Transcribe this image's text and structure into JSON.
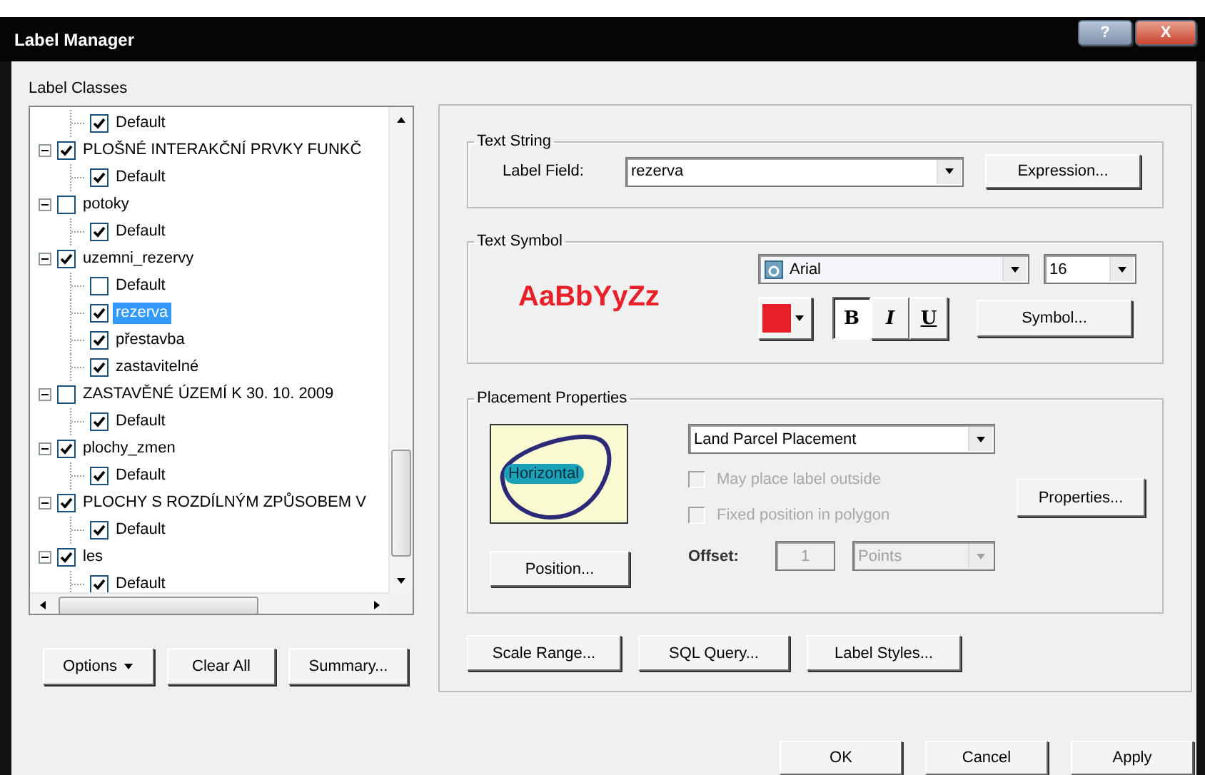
{
  "window": {
    "title": "Label Manager",
    "title_buttons": [
      {
        "label": "?",
        "kind": "help"
      },
      {
        "label": "X",
        "kind": "close"
      }
    ]
  },
  "label_classes": {
    "title": "Label Classes",
    "tree": {
      "continued_children": [
        {
          "label": "Default",
          "checked": true,
          "selected": false
        }
      ],
      "items": [
        {
          "label": "PLOŠNÉ INTERAKČNÍ PRVKY FUNKČ",
          "checked": true,
          "expanded": true,
          "selected": false,
          "children": [
            {
              "label": "Default",
              "checked": true,
              "selected": false
            }
          ]
        },
        {
          "label": "potoky",
          "checked": false,
          "expanded": true,
          "selected": false,
          "children": [
            {
              "label": "Default",
              "checked": true,
              "selected": false
            }
          ]
        },
        {
          "label": "uzemni_rezervy",
          "checked": true,
          "expanded": true,
          "selected": false,
          "children": [
            {
              "label": "Default",
              "checked": false,
              "selected": false
            },
            {
              "label": "rezerva",
              "checked": true,
              "selected": true
            },
            {
              "label": "přestavba",
              "checked": true,
              "selected": false
            },
            {
              "label": "zastavitelné",
              "checked": true,
              "selected": false
            }
          ]
        },
        {
          "label": "ZASTAVĚNÉ ÚZEMÍ K 30. 10. 2009",
          "checked": false,
          "expanded": true,
          "selected": false,
          "children": [
            {
              "label": "Default",
              "checked": true,
              "selected": false
            }
          ]
        },
        {
          "label": "plochy_zmen",
          "checked": true,
          "expanded": true,
          "selected": false,
          "children": [
            {
              "label": "Default",
              "checked": true,
              "selected": false
            }
          ]
        },
        {
          "label": "PLOCHY S ROZDÍLNÝM ZPŮSOBEM V",
          "checked": true,
          "expanded": true,
          "selected": false,
          "children": [
            {
              "label": "Default",
              "checked": true,
              "selected": false
            }
          ]
        },
        {
          "label": "les",
          "checked": true,
          "expanded": true,
          "selected": false,
          "children": [
            {
              "label": "Default",
              "checked": true,
              "selected": false
            }
          ]
        }
      ]
    },
    "buttons": [
      {
        "label": "Options",
        "kind": "menu"
      },
      {
        "label": "Clear All",
        "kind": "push"
      },
      {
        "label": "Summary...",
        "kind": "push"
      }
    ]
  },
  "text_string": {
    "title": "Text String",
    "label": "Label Field:",
    "value": "rezerva",
    "button": "Expression..."
  },
  "text_symbol": {
    "title": "Text Symbol",
    "preview": "AaBbYyZz",
    "color": "#e8202a",
    "font": "Arial",
    "size": "16",
    "styles": [
      {
        "label": "B",
        "kind": "bold",
        "pressed": true
      },
      {
        "label": "I",
        "kind": "italic",
        "pressed": false
      },
      {
        "label": "U",
        "kind": "underline",
        "pressed": false
      }
    ],
    "button": "Symbol..."
  },
  "placement": {
    "title": "Placement Properties",
    "preview_label": "Horizontal",
    "method": "Land Parcel Placement",
    "options": [
      {
        "label": "May place label outside",
        "checked": false,
        "disabled": true
      },
      {
        "label": "Fixed position in polygon",
        "checked": false,
        "disabled": true
      }
    ],
    "position_button": "Position...",
    "properties_button": "Properties...",
    "offset": {
      "label": "Offset:",
      "value": "1",
      "units": "Points",
      "disabled": true
    }
  },
  "actions": [
    "Scale Range...",
    "SQL Query...",
    "Label Styles..."
  ],
  "dialog_buttons": [
    "OK",
    "Cancel",
    "Apply"
  ]
}
